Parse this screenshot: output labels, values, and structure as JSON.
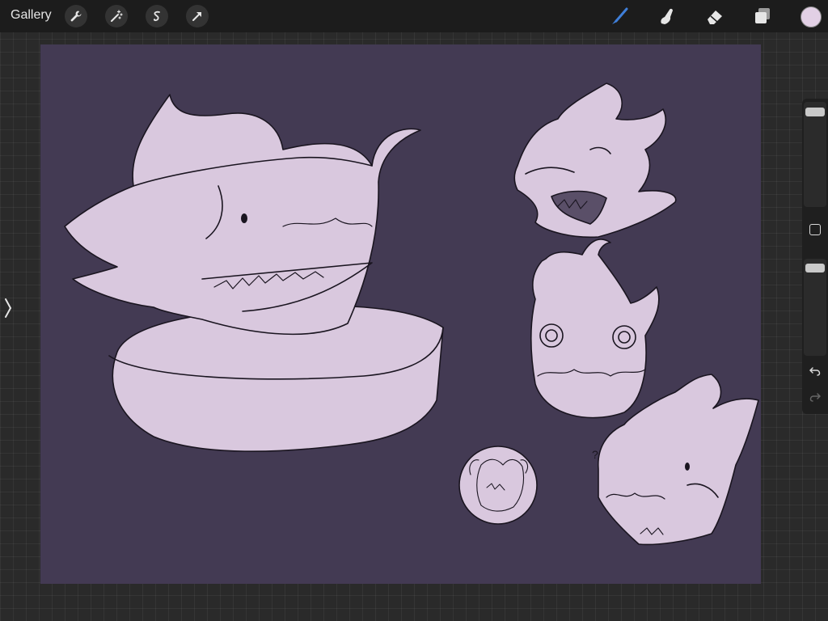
{
  "topbar": {
    "gallery_label": "Gallery",
    "left_tools": [
      "wrench-icon",
      "magic-wand-icon",
      "selection-icon",
      "transform-arrow-icon"
    ],
    "right_tools": [
      "brush-icon",
      "smudge-icon",
      "eraser-icon",
      "layers-icon"
    ]
  },
  "colors": {
    "canvas_background": "#433a53",
    "sketch_fill": "#d9c8de",
    "active_brush": "#3f7fd9",
    "current_color": "#e2d0e5"
  },
  "sidebar": {
    "brush_size_level": 0.05,
    "opacity_level": 0.05,
    "undo_icon": "undo-icon",
    "redo_icon": "redo-icon"
  },
  "canvas": {
    "sketch_mark": "?"
  }
}
